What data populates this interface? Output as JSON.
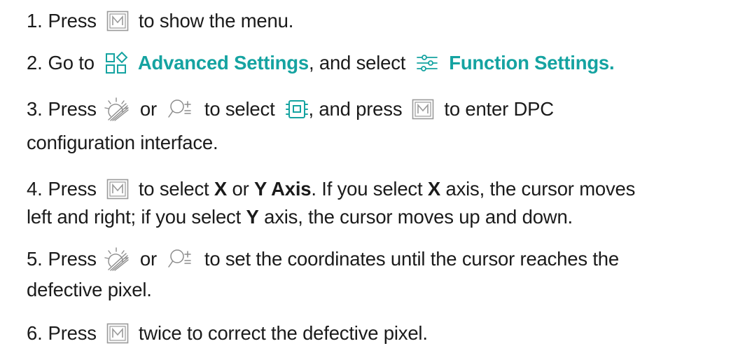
{
  "steps": [
    {
      "number": "1.",
      "t1": "Press",
      "t2": "to show the menu."
    },
    {
      "number": "2.",
      "t1": "Go to",
      "advanced": "Advanced Settings",
      "t2": ", and select",
      "function": "Function Settings."
    },
    {
      "number": "3.",
      "t1": "Press",
      "or": "or",
      "t2": "to select",
      "t3": ", and press",
      "t4": "to enter DPC",
      "cont": "configuration interface."
    },
    {
      "number": "4.",
      "t1": "Press",
      "t2": "to select",
      "x": "X",
      "or": "or",
      "yaxis": "Y Axis",
      "t3": ". If you select",
      "x2": "X",
      "t4": "axis, the cursor moves",
      "cont1": "left and right; if you select",
      "y2": "Y",
      "cont2": "axis, the cursor moves up and down."
    },
    {
      "number": "5.",
      "t1": "Press",
      "or": "or",
      "t2": "to set the coordinates until the cursor reaches the",
      "cont": "defective pixel."
    },
    {
      "number": "6.",
      "t1": "Press",
      "t2": "twice to correct the defective pixel."
    }
  ],
  "icons": {
    "menu_key": "m-key-icon",
    "advanced_settings": "advanced-settings-icon",
    "function_settings": "function-settings-icon",
    "brightness": "brightness-icon",
    "zoom": "zoom-icon",
    "dpc": "dpc-icon"
  },
  "colors": {
    "accent": "#15a3a1",
    "text": "#1b1b1b",
    "key_outline": "#9a9a9a"
  }
}
